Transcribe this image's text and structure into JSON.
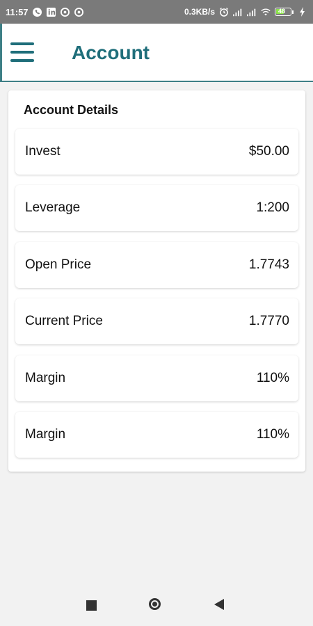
{
  "status_bar": {
    "time": "11:57",
    "net_speed": "0.3KB/s",
    "battery": "48"
  },
  "appbar": {
    "title": "Account"
  },
  "details": {
    "title": "Account Details",
    "rows": [
      {
        "label": "Invest",
        "value": "$50.00"
      },
      {
        "label": "Leverage",
        "value": "1:200"
      },
      {
        "label": "Open Price",
        "value": "1.7743"
      },
      {
        "label": "Current Price",
        "value": "1.7770"
      },
      {
        "label": "Margin",
        "value": "110%"
      },
      {
        "label": "Margin",
        "value": "110%"
      }
    ]
  },
  "colors": {
    "accent": "#1f6e7a",
    "status_bar": "#7a7a7a"
  },
  "icons": {
    "menu": "hamburger-menu",
    "nav": [
      "square-recents",
      "circle-home",
      "triangle-back"
    ]
  }
}
